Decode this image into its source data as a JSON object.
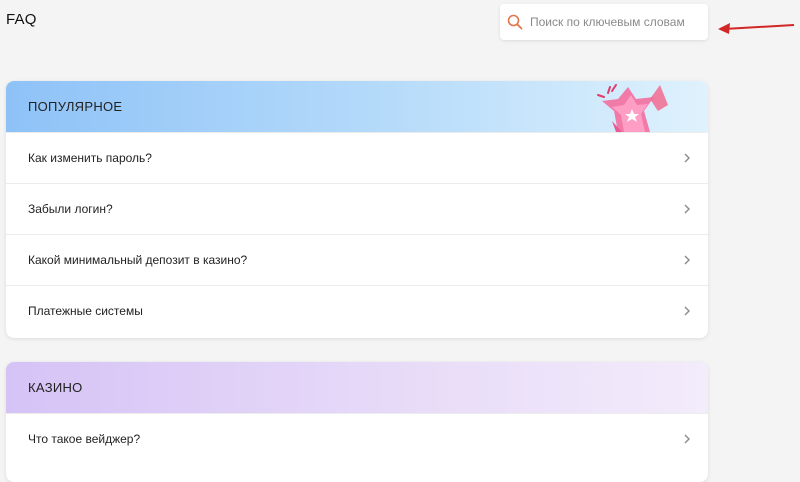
{
  "header": {
    "title": "FAQ"
  },
  "search": {
    "placeholder": "Поиск по ключевым словам",
    "value": ""
  },
  "sections": [
    {
      "title": "ПОПУЛЯРНОЕ",
      "items": [
        {
          "label": "Как изменить пароль?"
        },
        {
          "label": "Забыли логин?"
        },
        {
          "label": "Какой минимальный депозит в казино?"
        },
        {
          "label": "Платежные системы"
        }
      ]
    },
    {
      "title": "КАЗИНО",
      "items": [
        {
          "label": "Что такое вейджер?"
        }
      ]
    }
  ],
  "colors": {
    "background": "#f4f4f4",
    "search_icon": "#e0764a",
    "arrow": "#d32626",
    "popular_header_start": "#8ec2f7",
    "casino_header_start": "#d5c3f6",
    "chevron": "#8a8a8a"
  },
  "icons": {
    "search": "search-icon",
    "chevron": "chevron-right-icon",
    "arrow": "arrow-annotation",
    "decoration": "star-decoration-icon"
  }
}
